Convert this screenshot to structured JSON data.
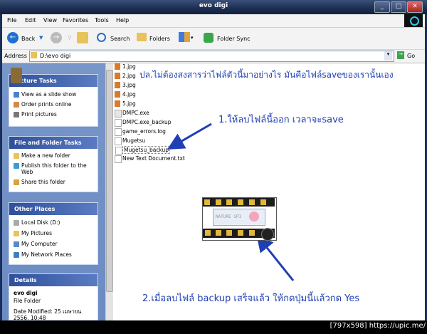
{
  "window": {
    "title": "evo digi"
  },
  "titlebar_buttons": {
    "minimize": "_",
    "maximize": "□",
    "close": "✕"
  },
  "menu": [
    "File",
    "Edit",
    "View",
    "Favorites",
    "Tools",
    "Help"
  ],
  "toolbar": {
    "back": "Back",
    "search": "Search",
    "folders": "Folders",
    "folder_sync": "Folder Sync"
  },
  "address": {
    "label": "Address",
    "value": "D:\\evo digi",
    "go": "Go"
  },
  "picture_tasks": {
    "title": "Picture Tasks",
    "items": [
      "View as a slide show",
      "Order prints online",
      "Print pictures"
    ]
  },
  "file_tasks": {
    "title": "File and Folder Tasks",
    "items": [
      "Make a new folder",
      "Publish this folder to the Web",
      "Share this folder"
    ]
  },
  "other_places": {
    "title": "Other Places",
    "items": [
      "Local Disk (D:)",
      "My Pictures",
      "My Computer",
      "My Network Places"
    ]
  },
  "details": {
    "title": "Details",
    "name": "evo digi",
    "type": "File Folder",
    "modified": "Date Modified: 25 เมษายน",
    "modified2": "2556, 10:48"
  },
  "files": [
    "1.jpg",
    "2.jpg",
    "3.jpg",
    "4.jpg",
    "5.jpg",
    "DMPC.exe",
    "DMPC.exe_backup",
    "game_errors.log",
    "Mugetsu",
    "Mugetsu_backup",
    "New Text Document.txt"
  ],
  "annotations": {
    "top": "ปล.ไม่ต้องสงสารว่าไฟล์ตัวนี้มาอย่างไร มันคือไฟล์saveของเรานั้นเอง",
    "step1": "1.ให้ลบไฟล์นี้ออก เวลาจะsave",
    "step2": "2.เมื่อลบไฟล์ backup เสร็จแล้ว ให้กดปุ่มนี้แล้วกด Yes"
  },
  "game_widget": {
    "label": "NATURE SPI"
  },
  "status": {
    "size": "[797x598]",
    "site": "https://upic.me/"
  },
  "colors": {
    "annotation": "#1f3fb4",
    "arrow": "#1f3fb4",
    "panel": "#6b8bc3"
  }
}
